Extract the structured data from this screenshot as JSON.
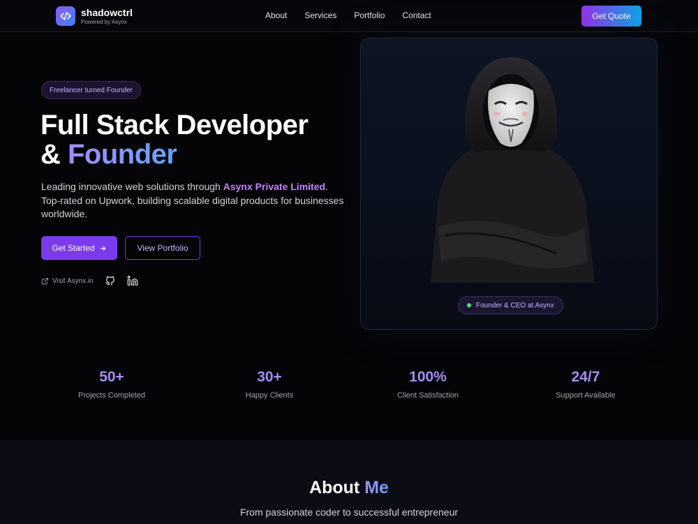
{
  "nav": {
    "brand": "shadowctrl",
    "brand_sub": "Powered by Asynx",
    "links": [
      "About",
      "Services",
      "Portfolio",
      "Contact"
    ],
    "cta": "Get Quote"
  },
  "hero": {
    "badge": "Freelancer turned Founder",
    "title_line1": "Full Stack Developer",
    "title_amp": "& ",
    "title_accent": "Founder",
    "lead_pre": "Leading innovative web solutions through ",
    "lead_highlight": "Asynx Private Limited",
    "lead_post": ". Top-rated on Upwork, building scalable digital products for businesses worldwide.",
    "primary_btn": "Get Started",
    "secondary_btn": "View Portfolio",
    "visit_link": "Visit Asynx.in",
    "icons": {
      "visit": "external-link-icon",
      "github": "github-icon",
      "linkedin": "linkedin-icon"
    }
  },
  "card": {
    "badge": "Founder & CEO at Asynx"
  },
  "stats": [
    {
      "value": "50+",
      "label": "Projects Completed"
    },
    {
      "value": "30+",
      "label": "Happy Clients"
    },
    {
      "value": "100%",
      "label": "Client Satisfaction"
    },
    {
      "value": "24/7",
      "label": "Support Available"
    }
  ],
  "about": {
    "title_pre": "About ",
    "title_accent": "Me",
    "subtitle": "From passionate coder to successful entrepreneur"
  },
  "colors": {
    "accent_purple": "#7c3aed",
    "accent_blue": "#0ea5e9",
    "stat_color": "#a78bfa",
    "background": "#050507"
  }
}
